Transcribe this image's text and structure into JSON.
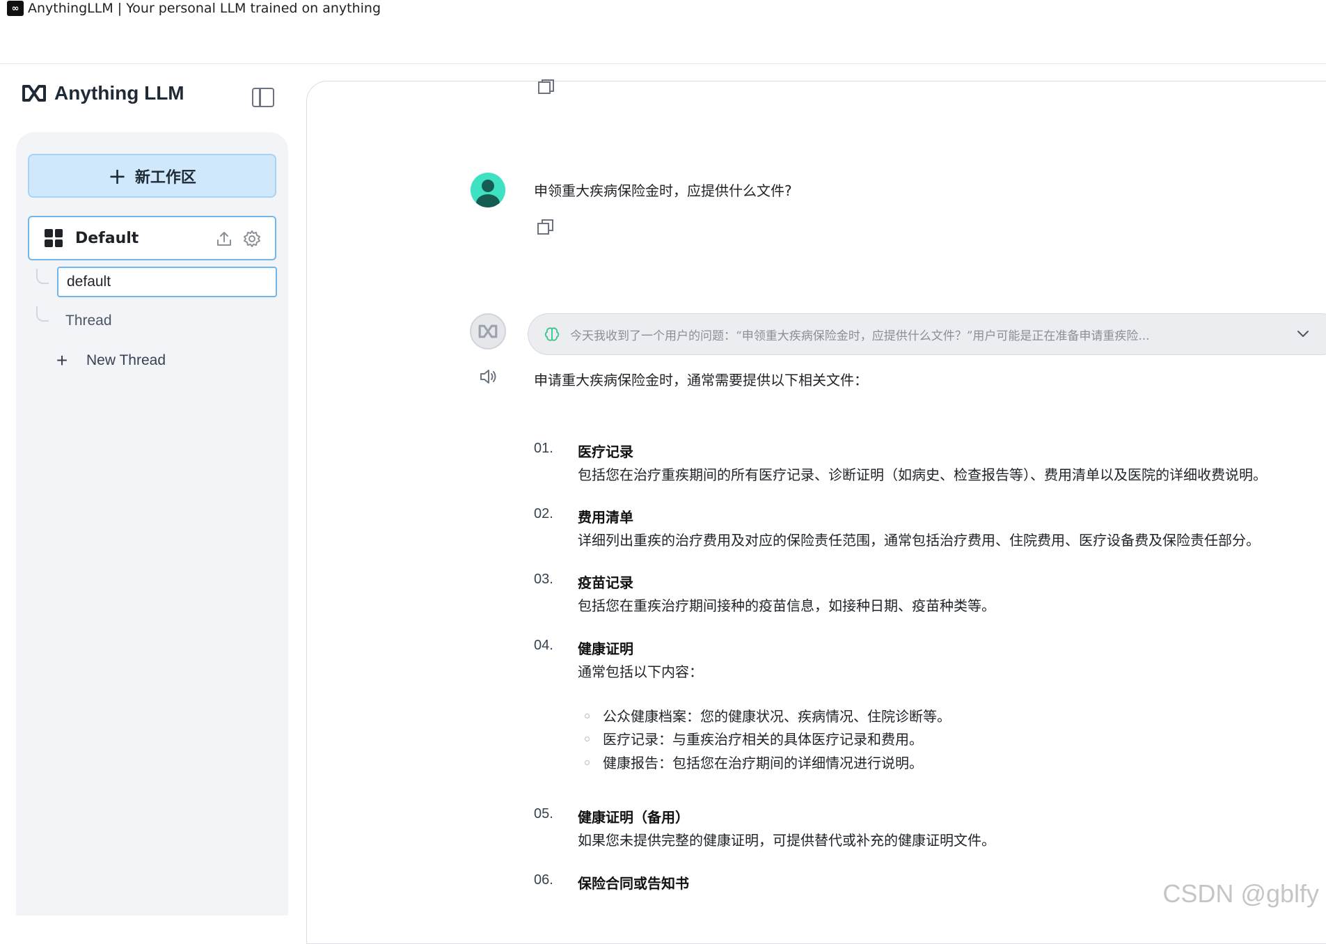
{
  "window": {
    "title": "AnythingLLM | Your personal LLM trained on anything"
  },
  "sidebar": {
    "brand": "Anything LLM",
    "new_workspace_label": "新工作区",
    "workspace": {
      "name": "Default"
    },
    "threads": {
      "active_input_value": "default",
      "items": [
        "Thread"
      ],
      "new_thread_label": "New Thread"
    }
  },
  "chat": {
    "user_message": "申领重大疾病保险金时，应提供什么文件?",
    "thinking_summary": "今天我收到了一个用户的问题：“申领重大疾病保险金时，应提供什么文件？”用户可能是正在准备申请重疾险...",
    "answer": {
      "intro": "申请重大疾病保险金时，通常需要提供以下相关文件：",
      "items": [
        {
          "num": "01.",
          "title": "医疗记录",
          "desc": "包括您在治疗重疾期间的所有医疗记录、诊断证明（如病史、检查报告等）、费用清单以及医院的详细收费说明。"
        },
        {
          "num": "02.",
          "title": "费用清单",
          "desc": "详细列出重疾的治疗费用及对应的保险责任范围，通常包括治疗费用、住院费用、医疗设备费及保险责任部分。"
        },
        {
          "num": "03.",
          "title": "疫苗记录",
          "desc": "包括您在重疾治疗期间接种的疫苗信息，如接种日期、疫苗种类等。"
        },
        {
          "num": "04.",
          "title": "健康证明",
          "desc": "通常包括以下内容："
        },
        {
          "num": "05.",
          "title": "健康证明（备用）",
          "desc": "如果您未提供完整的健康证明，可提供替代或补充的健康证明文件。"
        },
        {
          "num": "06.",
          "title": "保险合同或告知书",
          "desc": ""
        }
      ],
      "sub_bullets": [
        "公众健康档案：您的健康状况、疾病情况、住院诊断等。",
        "医疗记录：与重疾治疗相关的具体医疗记录和费用。",
        "健康报告：包括您在治疗期间的详细情况进行说明。"
      ]
    }
  },
  "watermark": "CSDN @gblfy",
  "colors": {
    "accent_blue": "#72b7ec",
    "new_workspace_bg": "#cfe8fb",
    "sidebar_bg": "#f2f4f7",
    "user_avatar": "#3ee2c2"
  },
  "icons": [
    "app-icon",
    "logo-icon",
    "sidebar-toggle-icon",
    "plus-icon",
    "grid-icon",
    "upload-icon",
    "gear-icon",
    "copy-icon",
    "user-avatar",
    "bot-avatar",
    "speaker-icon",
    "brain-icon",
    "chevron-down-icon"
  ]
}
